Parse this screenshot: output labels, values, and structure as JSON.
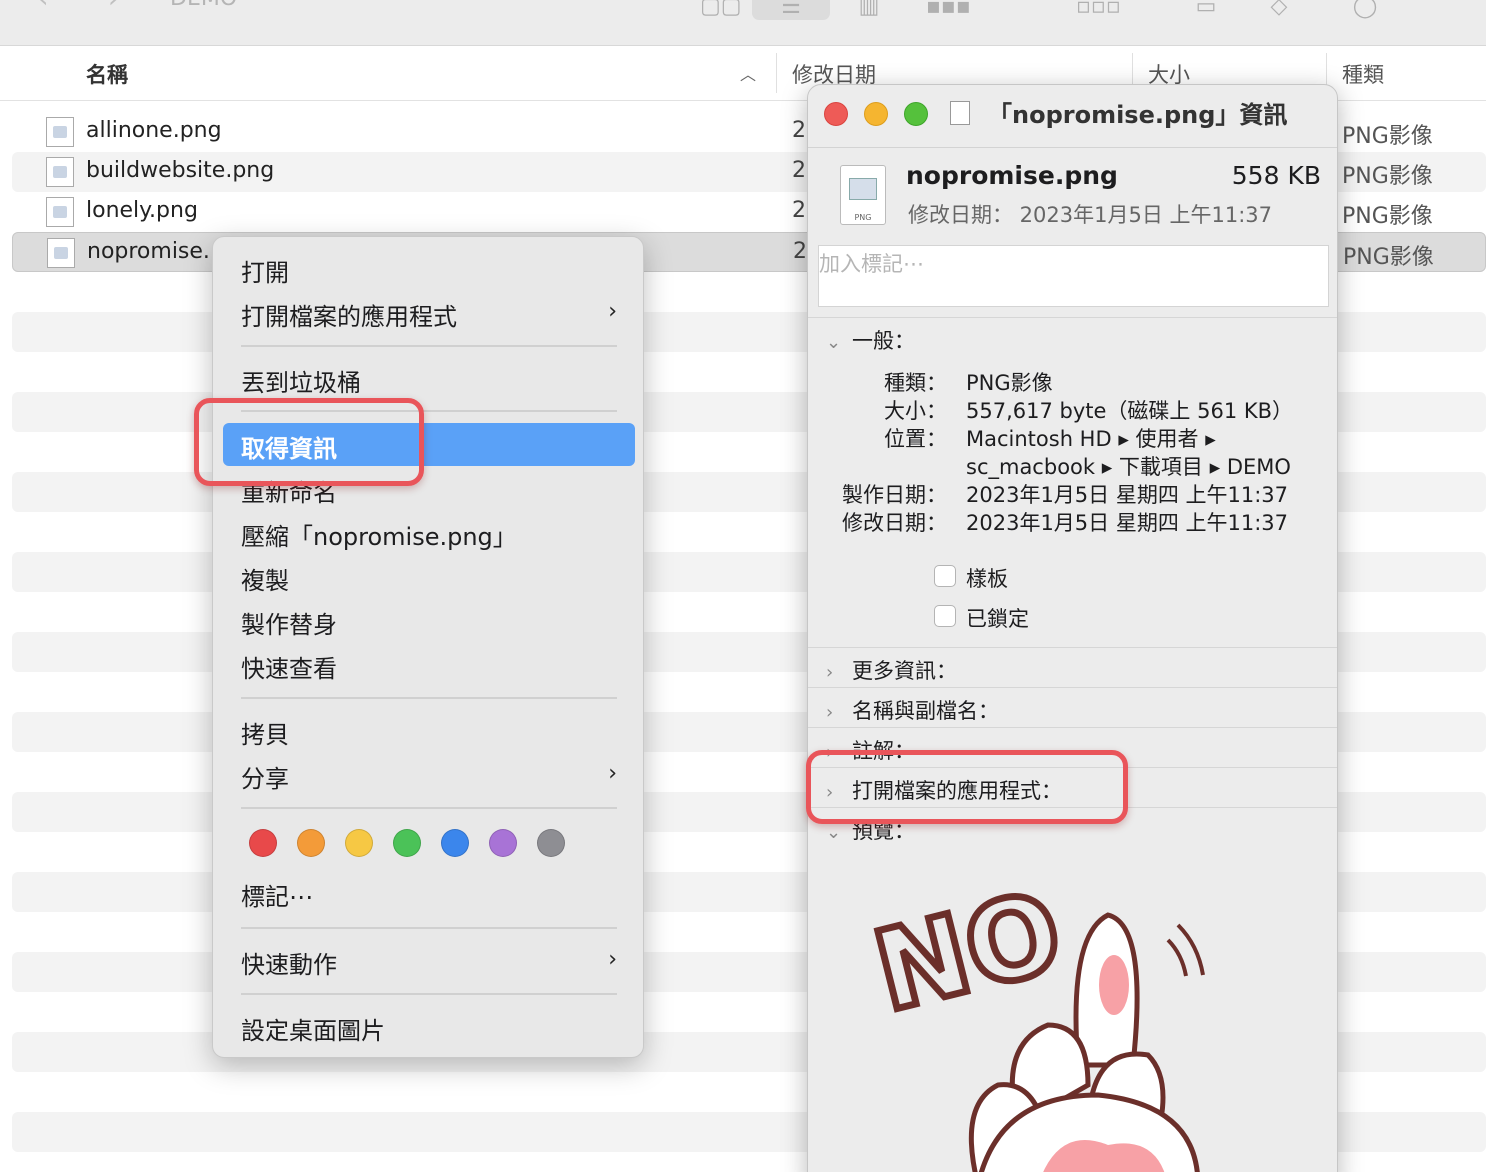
{
  "toolbar": {
    "back_label": "‹",
    "forward_label": "›",
    "folder_title": "DEMO"
  },
  "list": {
    "headers": {
      "name": "名稱",
      "modified": "修改日期",
      "size": "大小",
      "kind": "種類"
    },
    "rows": [
      {
        "name": "allinone.png",
        "date": "2",
        "kind": "PNG影像"
      },
      {
        "name": "buildwebsite.png",
        "date": "2",
        "kind": "PNG影像"
      },
      {
        "name": "lonely.png",
        "date": "2",
        "kind": "PNG影像"
      },
      {
        "name": "nopromise.",
        "date": "2",
        "kind": "PNG影像"
      }
    ]
  },
  "context_menu": {
    "items": [
      {
        "label": "打開"
      },
      {
        "label": "打開檔案的應用程式"
      },
      {
        "label": "丟到垃圾桶"
      },
      {
        "label": "取得資訊"
      },
      {
        "label": "重新命名"
      },
      {
        "label": "壓縮「nopromise.png」"
      },
      {
        "label": "複製"
      },
      {
        "label": "製作替身"
      },
      {
        "label": "快速查看"
      },
      {
        "label": "拷貝"
      },
      {
        "label": "分享"
      },
      {
        "label": "標記⋯"
      },
      {
        "label": "快速動作"
      },
      {
        "label": "設定桌面圖片"
      }
    ],
    "tag_colors": [
      "#e8494a",
      "#f39b39",
      "#f6c844",
      "#4bc258",
      "#3b86ec",
      "#a873d6",
      "#8e8e93"
    ]
  },
  "info_panel": {
    "title": "「nopromise.png」資訊",
    "file_name": "nopromise.png",
    "file_size": "558 KB",
    "modified_line": "修改日期： 2023年1月5日 上午11:37",
    "icon_label": "PNG",
    "tag_placeholder": "加入標記⋯",
    "general": {
      "header": "一般：",
      "kind_key": "種類：",
      "kind_val": "PNG影像",
      "size_key": "大小：",
      "size_val": "557,617 byte（磁碟上 561 KB）",
      "where_key": "位置：",
      "where_val_1": "Macintosh HD ▸ 使用者 ▸",
      "where_val_2": "sc_macbook ▸ 下載項目 ▸ DEMO",
      "created_key": "製作日期：",
      "created_val": "2023年1月5日 星期四 上午11:37",
      "modified_key": "修改日期：",
      "modified_val": "2023年1月5日 星期四 上午11:37",
      "stationery_label": "樣板",
      "locked_label": "已鎖定"
    },
    "sections": {
      "more_info": "更多資訊：",
      "name_ext": "名稱與副檔名：",
      "comments": "註解：",
      "open_with": "打開檔案的應用程式：",
      "preview": "預覽："
    },
    "preview_text": "NO"
  }
}
